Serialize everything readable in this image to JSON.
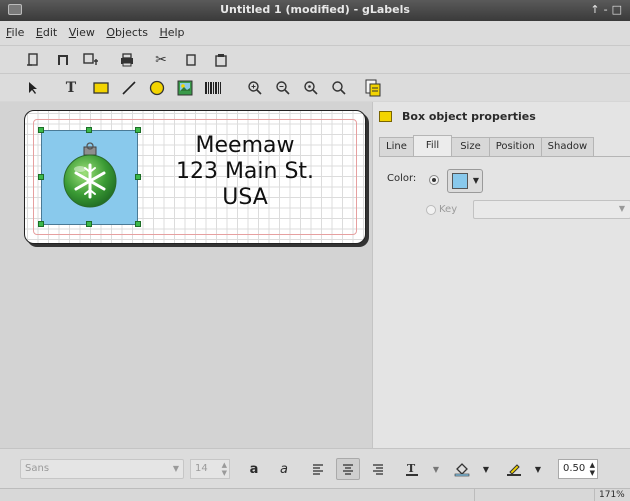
{
  "window": {
    "title": "Untitled 1 (modified) - gLabels"
  },
  "menu": [
    "File",
    "Edit",
    "View",
    "Objects",
    "Help"
  ],
  "toolbar_main": [
    "new-icon",
    "open-icon",
    "save-icon",
    "print-icon",
    "cut-icon",
    "copy-icon",
    "paste-icon"
  ],
  "toolbar_objects": [
    "arrow-select-icon",
    "text-tool-icon",
    "box-tool-icon",
    "line-tool-icon",
    "ellipse-tool-icon",
    "image-tool-icon",
    "barcode-tool-icon",
    "zoom-in-icon",
    "zoom-out-icon",
    "zoom-1to1-icon",
    "zoom-fit-icon",
    "merge-properties-icon"
  ],
  "label": {
    "address": [
      "Meemaw",
      "123 Main St.",
      "USA"
    ],
    "image_fill": "#89c9ec"
  },
  "properties": {
    "title": "Box object properties",
    "tabs": [
      "Line",
      "Fill",
      "Size",
      "Position",
      "Shadow"
    ],
    "active_tab": "Fill",
    "color_label": "Color:",
    "key_label": "Key",
    "fill_color": "#89c9ec"
  },
  "format": {
    "font_family": "Sans",
    "font_size": "14",
    "line_width": "0.50"
  },
  "status": {
    "zoom": "171%"
  }
}
